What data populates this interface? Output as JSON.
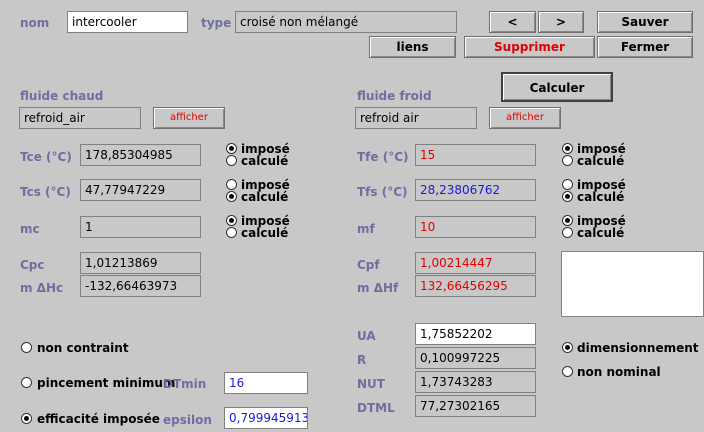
{
  "top": {
    "nom_label": "nom",
    "nom_value": "intercooler",
    "type_label": "type",
    "type_value": "croisé non mélangé",
    "prev_label": "<",
    "next_label": ">",
    "save_label": "Sauver",
    "links_label": "liens",
    "delete_label": "Supprimer",
    "close_label": "Fermer",
    "compute_label": "Calculer"
  },
  "hot": {
    "title": "fluide chaud",
    "fluid_name": "refroid_air",
    "show_label": "afficher",
    "tce_label": "Tce (°C)",
    "tce_value": "178,85304985",
    "tcs_label": "Tcs (°C)",
    "tcs_value": "47,77947229",
    "mc_label": "mc",
    "mc_value": "1",
    "cpc_label": "Cpc",
    "cpc_value": "1,01213869",
    "mdhc_label": "m ΔHc",
    "mdhc_value": "-132,66463973"
  },
  "cold": {
    "title": "fluide froid",
    "fluid_name": "refroid air",
    "show_label": "afficher",
    "tfe_label": "Tfe (°C)",
    "tfe_value": "15",
    "tfs_label": "Tfs (°C)",
    "tfs_value": "28,23806762",
    "mf_label": "mf",
    "mf_value": "10",
    "cpf_label": "Cpf",
    "cpf_value": "1,00214447",
    "mdhf_label": "m ΔHf",
    "mdhf_value": "132,66456295"
  },
  "radios": {
    "impose": "imposé",
    "calcule": "calculé"
  },
  "constraints": {
    "none_label": "non contraint",
    "pinch_label": "pincement minimum",
    "dtmin_label": "DTmin",
    "dtmin_value": "16",
    "eff_label": "efficacité imposée",
    "epsilon_label": "epsilon",
    "epsilon_value": "0,799945913"
  },
  "results": {
    "ua_label": "UA",
    "ua_value": "1,75852202",
    "r_label": "R",
    "r_value": "0,100997225",
    "nut_label": "NUT",
    "nut_value": "1,73743283",
    "dtml_label": "DTML",
    "dtml_value": "77,27302165"
  },
  "mode": {
    "design_label": "dimensionnement",
    "offdesign_label": "non nominal"
  }
}
